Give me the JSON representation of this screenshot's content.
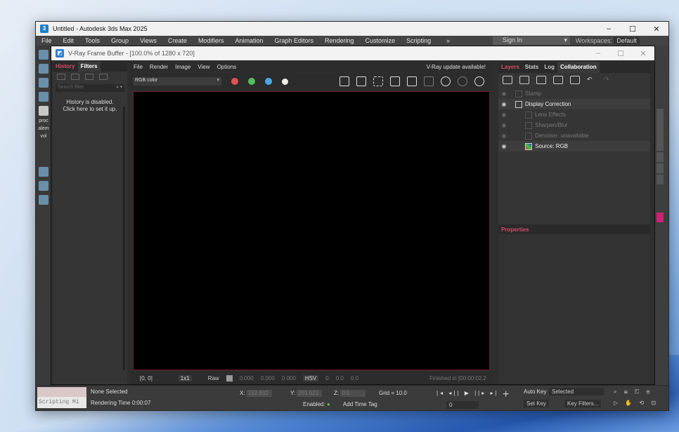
{
  "max": {
    "title": "Untitled - Autodesk 3ds Max 2025",
    "menu": [
      "File",
      "Edit",
      "Tools",
      "Group",
      "Views",
      "Create",
      "Modifiers",
      "Animation",
      "Graph Editors",
      "Rendering",
      "Customize",
      "Scripting"
    ],
    "more": "»",
    "sign_in": "Sign In",
    "workspaces_label": "Workspaces:",
    "workspace": "Default",
    "left_labels": [
      "proc",
      "alem",
      "vol"
    ],
    "status": {
      "selection": "None Selected",
      "render_time": "Rendering Time  0:00:07",
      "x_label": "X:",
      "x_value": "152.832",
      "y_label": "Y:",
      "y_value": "291.021",
      "z_label": "Z:",
      "z_value": "0.0",
      "grid": "Grid = 10.0",
      "enabled_label": "Enabled:",
      "add_time_tag": "Add Time Tag",
      "frame": "0",
      "auto_key": "Auto Key",
      "selected": "Selected",
      "set_key": "Set Key",
      "key_filters": "Key Filters...",
      "scripting": "Scripting Mi"
    }
  },
  "vfb": {
    "title": "V-Ray Frame Buffer - [100.0% of 1280 x 720]",
    "left_tabs": [
      "History",
      "Filters"
    ],
    "search_placeholder": "Search filter",
    "history_msg_1": "History is disabled.",
    "history_msg_2": "Click here to set it up.",
    "menu": [
      "File",
      "Render",
      "Image",
      "View",
      "Options"
    ],
    "update": "V-Ray update available!",
    "channel": "RGB color",
    "dots": [
      "#e05252",
      "#52c05a",
      "#4aa8e8"
    ],
    "bottom": {
      "coords": "[0, 0]",
      "zoom": "1x1",
      "raw": "Raw",
      "v1": "0.000",
      "v2": "0.000",
      "v3": "0.000",
      "mode": "HSV",
      "h": "0",
      "s": "0.0",
      "v": "0.0",
      "finished": "Finished in [00:00:02.2"
    },
    "right_tabs": [
      "Layers",
      "Stats",
      "Log",
      "Collaboration"
    ],
    "layers": [
      {
        "name": "Stamp",
        "on": false,
        "indent": 1
      },
      {
        "name": "Display Correction",
        "on": true,
        "indent": 1
      },
      {
        "name": "Lens Effects",
        "on": false,
        "indent": 2
      },
      {
        "name": "Sharpen/Blur",
        "on": false,
        "indent": 2
      },
      {
        "name": "Denoiser: unavailable",
        "on": false,
        "indent": 2
      },
      {
        "name": "Source: RGB",
        "on": true,
        "indent": 2
      }
    ],
    "properties": "Properties"
  },
  "accent": "#d54a6a"
}
